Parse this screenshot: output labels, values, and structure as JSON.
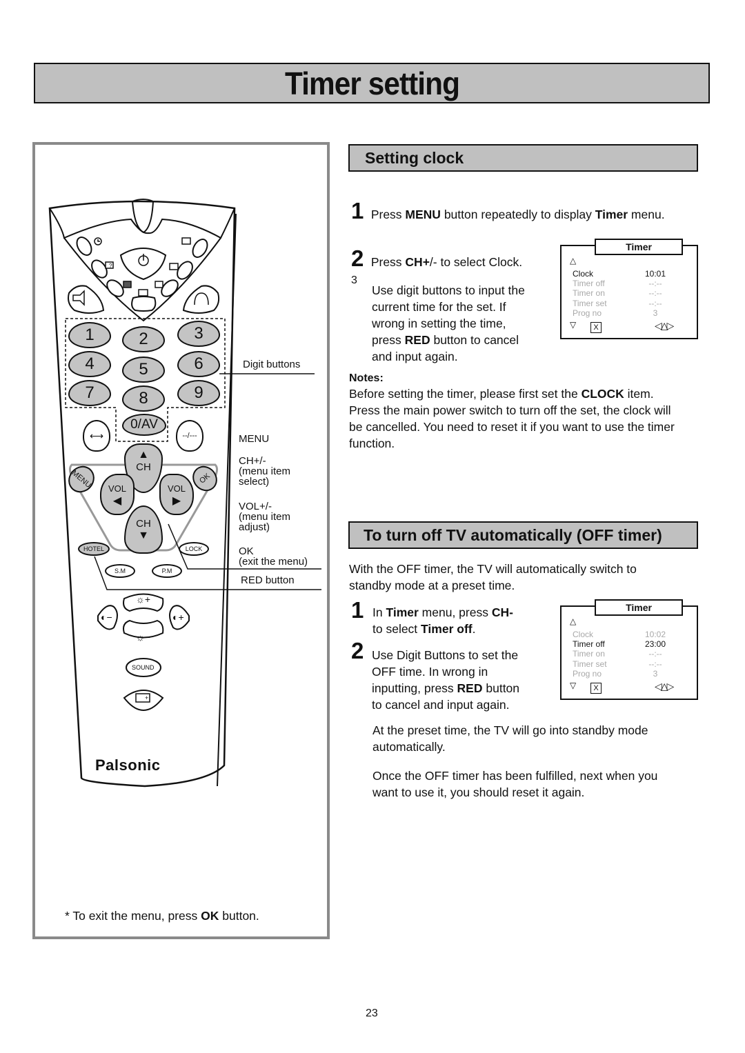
{
  "page": {
    "title": "Timer setting",
    "page_number": "23"
  },
  "remote": {
    "brand": "Palsonic",
    "digits": [
      "1",
      "2",
      "3",
      "4",
      "5",
      "6",
      "7",
      "8",
      "9"
    ],
    "zero_av": "0/AV",
    "dash_button": "--/---",
    "ch_label": "CH",
    "vol_label": "VOL",
    "menu_label": "MENU",
    "ok_label": "OK",
    "hotel_label": "HOTEL",
    "lock_label": "LOCK",
    "sm_label": "S.M",
    "pm_label": "P.M",
    "sound_label": "SOUND",
    "annotations": {
      "digit_buttons": "Digit buttons",
      "menu": "MENU",
      "ch_title": "CH+/-",
      "ch_desc1": "(menu item",
      "ch_desc2": "select)",
      "vol_title": "VOL+/-",
      "vol_desc1": "(menu item",
      "vol_desc2": "adjust)",
      "ok_title": "OK",
      "ok_desc": "(exit the menu)",
      "red_button": "RED button"
    },
    "footnote_pre": "* To exit the menu, press ",
    "footnote_bold": "OK",
    "footnote_post": " button."
  },
  "setting_clock": {
    "heading": "Setting clock",
    "step1": {
      "num": "1",
      "t1": "Press ",
      "b1": "MENU",
      "t2": " button repeatedly to display ",
      "b2": "Timer",
      "t3": " menu."
    },
    "step2": {
      "num": "2",
      "t1": "Press ",
      "b1": "CH+",
      "t2": "/- to select Clock."
    },
    "step3": {
      "num": "3",
      "line1": "Use digit buttons to input the",
      "line2": "current time for the set. If",
      "line3": "wrong in setting the time,",
      "line4_pre": "press ",
      "line4_bold": "RED",
      "line4_post": " button to cancel",
      "line5": "and input again."
    },
    "notes_label": "Notes:",
    "notes_pre": "Before setting the timer, please first set the ",
    "notes_bold": "CLOCK",
    "notes_post": " item.",
    "notes_line2": "Press the main power switch to turn off the set, the clock will",
    "notes_line3": "be cancelled. You need to reset it if you want to use the timer",
    "notes_line4": "function.",
    "osd": {
      "title": "Timer",
      "rows": [
        {
          "label": "Clock",
          "value": "10:01",
          "active": true
        },
        {
          "label": "Timer off",
          "value": "--:--",
          "active": false
        },
        {
          "label": "Timer on",
          "value": "--:--",
          "active": false
        },
        {
          "label": "Timer set",
          "value": "--:--",
          "active": false
        },
        {
          "label": "Prog no",
          "value": "3",
          "active": false
        }
      ],
      "p_up": "P+",
      "p_down": "P-",
      "close": "X"
    }
  },
  "off_timer": {
    "heading": "To turn off TV automatically (OFF timer)",
    "intro_line1": "With the OFF timer, the TV will automatically switch to",
    "intro_line2": "standby mode at a preset time.",
    "step1": {
      "num": "1",
      "t1": "In ",
      "b1": "Timer",
      "t2": " menu, press ",
      "b2": "CH-",
      "t3": "to select ",
      "b3": "Timer off",
      "t4": "."
    },
    "step2": {
      "num": "2",
      "line1": "Use Digit Buttons to set the",
      "line2": "OFF time. In wrong in",
      "line3_pre": "inputting, press ",
      "line3_bold": "RED",
      "line3_post": " button",
      "line4": "to cancel and input again."
    },
    "para1_line1": "At the preset time, the TV will go into standby mode",
    "para1_line2": "automatically.",
    "para2_line1": "Once the OFF timer has been fulfilled, next when you",
    "para2_line2": "want to use it, you should reset it again.",
    "osd": {
      "title": "Timer",
      "rows": [
        {
          "label": "Clock",
          "value": "10:02",
          "active": false
        },
        {
          "label": "Timer off",
          "value": "23:00",
          "active": true
        },
        {
          "label": "Timer on",
          "value": "--:--",
          "active": false
        },
        {
          "label": "Timer set",
          "value": "--:--",
          "active": false
        },
        {
          "label": "Prog no",
          "value": "3",
          "active": false
        }
      ],
      "p_up": "P+",
      "p_down": "P-",
      "close": "X"
    }
  }
}
